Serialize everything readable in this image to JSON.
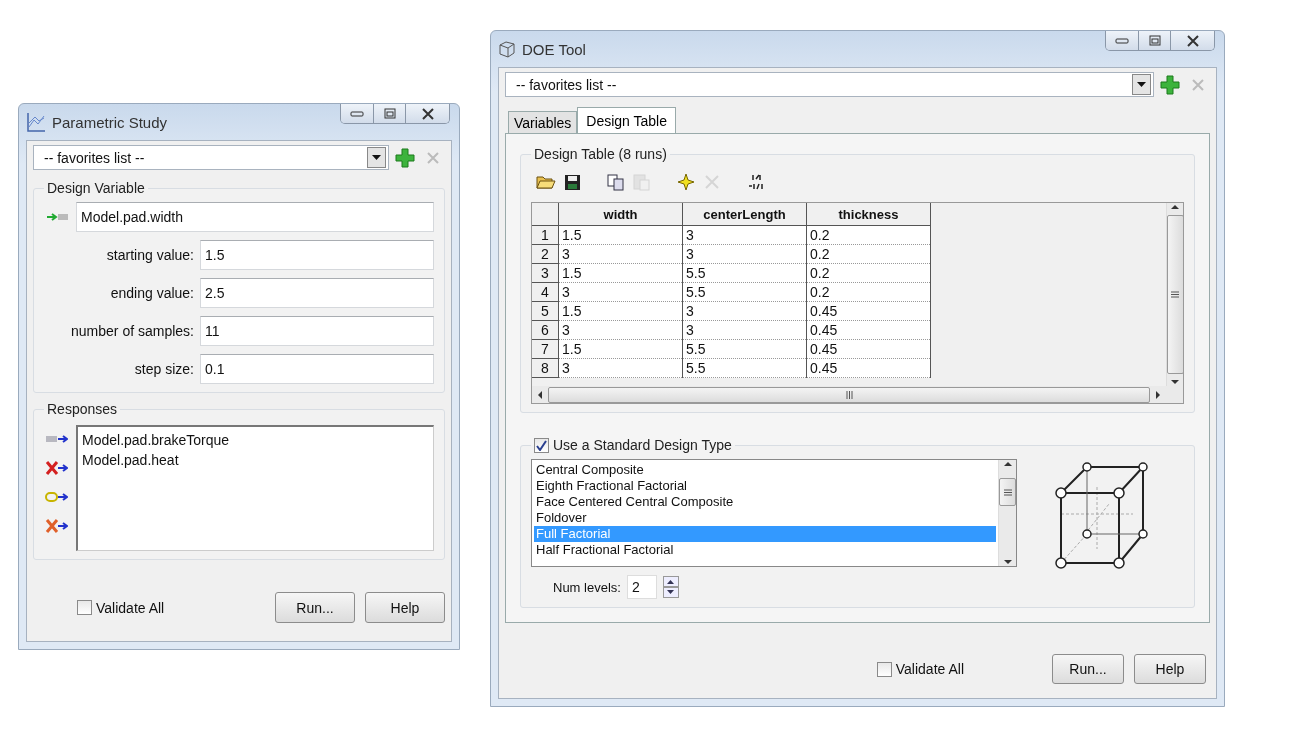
{
  "parametric_study": {
    "title": "Parametric Study",
    "favorites": "-- favorites list --",
    "design_variable": {
      "title": "Design Variable",
      "variable": "Model.pad.width",
      "fields": [
        {
          "label": "starting value:",
          "value": "1.5"
        },
        {
          "label": "ending value:",
          "value": "2.5"
        },
        {
          "label": "number of samples:",
          "value": "11"
        },
        {
          "label": "step size:",
          "value": "0.1"
        }
      ]
    },
    "responses": {
      "title": "Responses",
      "tools": [
        {
          "kind": "add"
        },
        {
          "kind": "remove"
        },
        {
          "kind": "link"
        },
        {
          "kind": "remove-all"
        }
      ],
      "items": [
        "Model.pad.brakeTorque",
        "Model.pad.heat"
      ]
    },
    "validate_all": {
      "label": "Validate All",
      "checked": false
    },
    "buttons": [
      "Run...",
      "Help"
    ]
  },
  "doe_tool": {
    "title": "DOE Tool",
    "favorites": "-- favorites list --",
    "tabs": [
      {
        "label": "Variables",
        "selected": false
      },
      {
        "label": "Design Table",
        "selected": true
      }
    ],
    "design_table": {
      "title": "Design Table (8 runs)",
      "toolbar": [
        {
          "kind": "open",
          "disabled": false
        },
        {
          "kind": "save",
          "disabled": false
        },
        {
          "kind": "copy",
          "disabled": false
        },
        {
          "kind": "paste",
          "disabled": true
        },
        {
          "kind": "generate",
          "disabled": false
        },
        {
          "kind": "delete",
          "disabled": true
        },
        {
          "kind": "matrix",
          "disabled": false
        }
      ],
      "columns": [
        "width",
        "centerLength",
        "thickness"
      ],
      "rows": [
        {
          "index": "1",
          "cells": [
            "1.5",
            "3",
            "0.2"
          ]
        },
        {
          "index": "2",
          "cells": [
            "3",
            "3",
            "0.2"
          ]
        },
        {
          "index": "3",
          "cells": [
            "1.5",
            "5.5",
            "0.2"
          ]
        },
        {
          "index": "4",
          "cells": [
            "3",
            "5.5",
            "0.2"
          ]
        },
        {
          "index": "5",
          "cells": [
            "1.5",
            "3",
            "0.45"
          ]
        },
        {
          "index": "6",
          "cells": [
            "3",
            "3",
            "0.45"
          ]
        },
        {
          "index": "7",
          "cells": [
            "1.5",
            "5.5",
            "0.45"
          ]
        },
        {
          "index": "8",
          "cells": [
            "3",
            "5.5",
            "0.45"
          ]
        }
      ]
    },
    "standard_design": {
      "label": "Use a Standard Design Type",
      "checked": true,
      "types": [
        {
          "label": "Central Composite",
          "selected": false
        },
        {
          "label": "Eighth Fractional Factorial",
          "selected": false
        },
        {
          "label": "Face Centered Central Composite",
          "selected": false
        },
        {
          "label": "Foldover",
          "selected": false
        },
        {
          "label": "Full Factorial",
          "selected": true
        },
        {
          "label": "Half Fractional Factorial",
          "selected": false
        }
      ],
      "num_levels": {
        "label": "Num levels:",
        "value": "2"
      }
    },
    "validate_all": {
      "label": "Validate All",
      "checked": false
    },
    "buttons": [
      "Run...",
      "Help"
    ]
  }
}
